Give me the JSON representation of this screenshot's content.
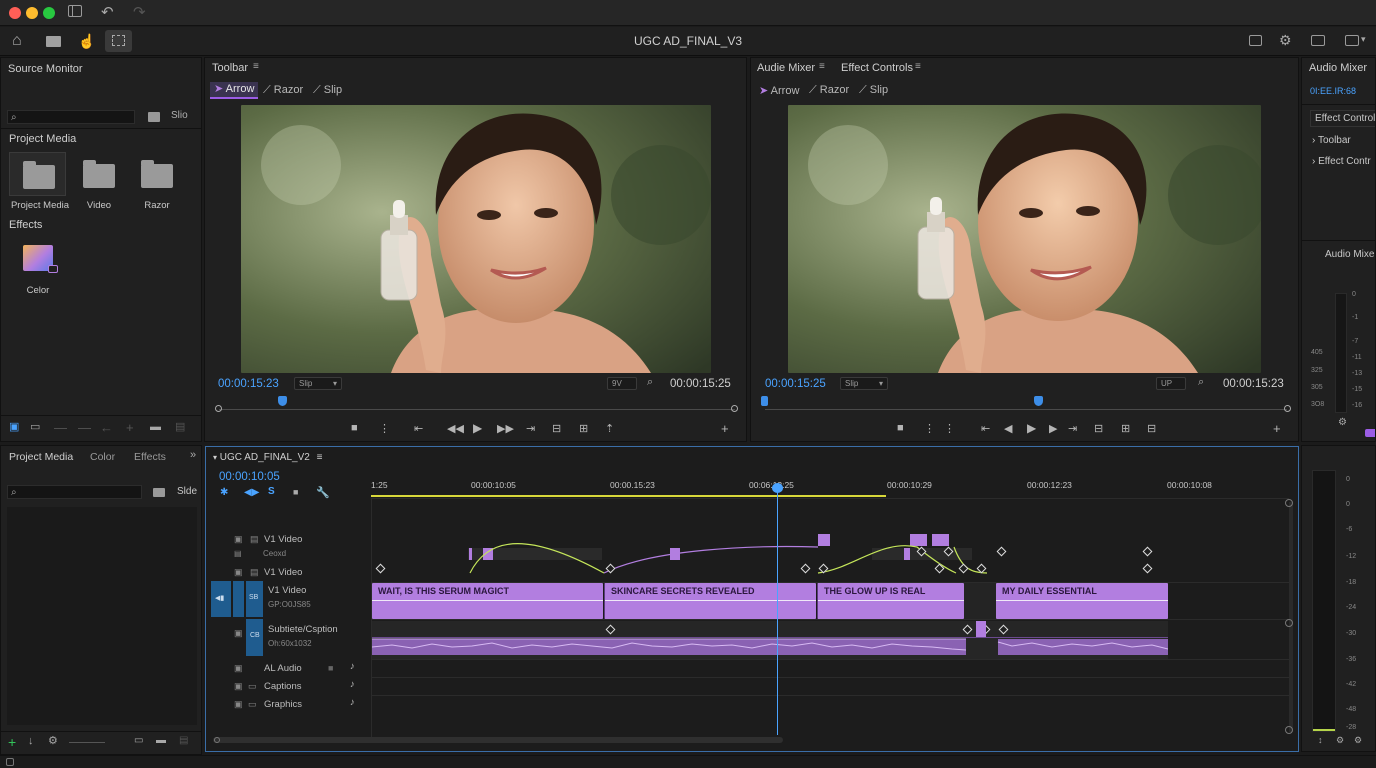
{
  "app": {
    "title": "UGC AD_FINAL_V3"
  },
  "colors": {
    "accent": "#b27ee0",
    "playhead": "#4aa3ff",
    "timecode": "#4aa3ff"
  },
  "source_monitor": {
    "title": "Source Monitor",
    "search_placeholder": "",
    "slide_label": "Slio",
    "project_media_label": "Project Media",
    "bins": [
      {
        "label": "Project Media"
      },
      {
        "label": "Video"
      },
      {
        "label": "Razor"
      }
    ],
    "effects_label": "Effects",
    "effect_item": "Celor"
  },
  "program_left": {
    "tab": "Toolbar",
    "tools": [
      "Arrow",
      "Razor",
      "Slip"
    ],
    "timecode_in": "00:00:15:23",
    "dropdown": "Slip",
    "zoom": "9V",
    "timecode_out": "00:00:15:25"
  },
  "program_right": {
    "tabs": [
      "Audie Mixer",
      "Effect Controls"
    ],
    "tools": [
      "Arrow",
      "Razor",
      "Slip"
    ],
    "timecode_in": "00:00:15:25",
    "dropdown": "Slip",
    "zoom": "UP",
    "timecode_out": "00:00:15:23"
  },
  "right_panel": {
    "title": "Audio Mixer",
    "timecode": "0I:EE.IR:68",
    "items": [
      "Effect Control",
      "Toolbar",
      "Effect Contr"
    ],
    "audio_label": "Audio Mixe",
    "meter_ticks": [
      "0",
      "-1",
      "-5",
      "-7",
      "-11",
      "-13",
      "-15",
      "-16",
      "-18"
    ],
    "meter_left_ticks": [
      "405",
      "325",
      "305",
      "3O8"
    ]
  },
  "project_panel": {
    "tabs": [
      "Project Media",
      "Color",
      "Effects"
    ],
    "slide_label": "Slde"
  },
  "timeline": {
    "name": "UGC AD_FINAL_V2",
    "timecode": "00:00:10:05",
    "ruler": [
      "1:25",
      "00:00:10:05",
      "00:00.15:23",
      "00:06:13:25",
      "00:00:10:29",
      "00:00:12:23",
      "00:00:10:08"
    ],
    "tracks": {
      "v2": "V1 Video",
      "v2sub": "Ceoxd",
      "v1": "V1 Video",
      "v1main": "V1 Video",
      "v1main_sub": "GP:O0JS85",
      "caption_track": "Subtiete/Csption",
      "caption_sub": "Oh:60x1032",
      "audio": "AL  Audio",
      "captions": "Captions",
      "graphics": "Graphics"
    },
    "clips": [
      "WAIT, IS THIS SERUM MAGICT",
      "SKINCARE SECRETS REVEALED",
      "THE GLOW UP IS REAL",
      "MY DAILY ESSENTIAL"
    ]
  },
  "right_meter": {
    "ticks": [
      "0",
      "0",
      "-6",
      "-12",
      "-18",
      "-24",
      "-30",
      "-36",
      "-42",
      "-48",
      "-54",
      "-28"
    ]
  }
}
